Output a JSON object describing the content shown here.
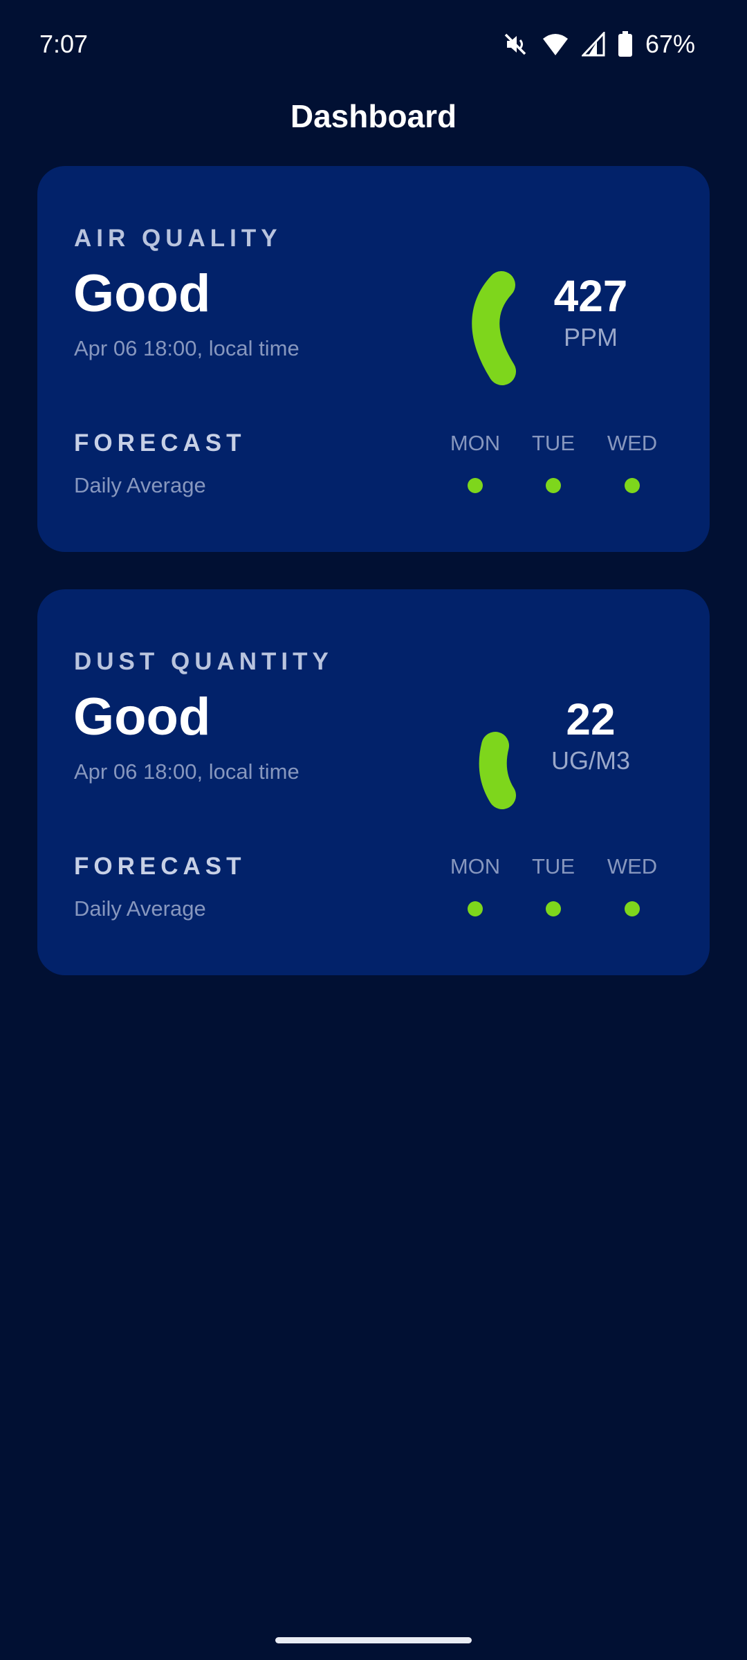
{
  "status_bar": {
    "time": "7:07",
    "battery_percent": "67%",
    "icons": [
      "mute-icon",
      "wifi-icon",
      "signal-icon",
      "battery-icon"
    ]
  },
  "page": {
    "title": "Dashboard"
  },
  "colors": {
    "background": "#011033",
    "card": "#02226a",
    "good": "#7ed61c"
  },
  "cards": [
    {
      "label": "AIR QUALITY",
      "status": "Good",
      "timestamp": "Apr 06 18:00, local time",
      "value": "427",
      "unit": "PPM",
      "forecast_label": "FORECAST",
      "forecast_sub": "Daily Average",
      "forecast_days": [
        "MON",
        "TUE",
        "WED"
      ]
    },
    {
      "label": "DUST QUANTITY",
      "status": "Good",
      "timestamp": "Apr 06 18:00, local time",
      "value": "22",
      "unit": "UG/M3",
      "forecast_label": "FORECAST",
      "forecast_sub": "Daily Average",
      "forecast_days": [
        "MON",
        "TUE",
        "WED"
      ]
    }
  ]
}
